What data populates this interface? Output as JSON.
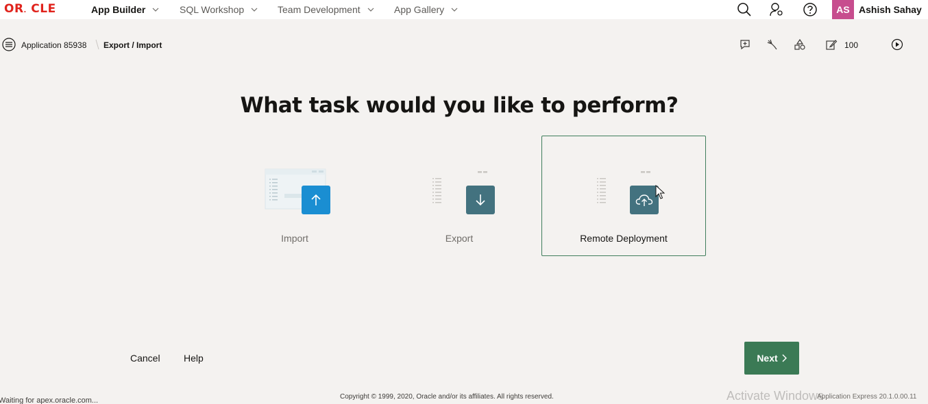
{
  "brand": {
    "logo_text": "ORACLE"
  },
  "nav": {
    "items": [
      {
        "label": "App Builder",
        "active": true
      },
      {
        "label": "SQL Workshop",
        "active": false
      },
      {
        "label": "Team Development",
        "active": false
      },
      {
        "label": "App Gallery",
        "active": false
      }
    ]
  },
  "user": {
    "initials": "AS",
    "name": "Ashish Sahay"
  },
  "breadcrumb": {
    "items": [
      "Application 85938",
      "Export / Import"
    ]
  },
  "toolbar": {
    "page_number": "100"
  },
  "main": {
    "heading": "What task would you like to perform?",
    "cards": [
      {
        "label": "Import",
        "icon": "upload-arrow-icon",
        "selected": false
      },
      {
        "label": "Export",
        "icon": "download-arrow-icon",
        "selected": false
      },
      {
        "label": "Remote Deployment",
        "icon": "cloud-upload-icon",
        "selected": true
      }
    ]
  },
  "actions": {
    "cancel_label": "Cancel",
    "help_label": "Help",
    "next_label": "Next"
  },
  "footer": {
    "copyright": "Copyright © 1999, 2020, Oracle and/or its affiliates. All rights reserved.",
    "version": "Application Express 20.1.0.00.11",
    "status": "Waiting for apex.oracle.com...",
    "watermark": "Activate Windows"
  },
  "colors": {
    "accent_green": "#3b7a55",
    "import_blue": "#1a8ed2",
    "tile_teal": "#43727f",
    "avatar_pink": "#c74d8e",
    "oracle_red": "#e0231c"
  }
}
